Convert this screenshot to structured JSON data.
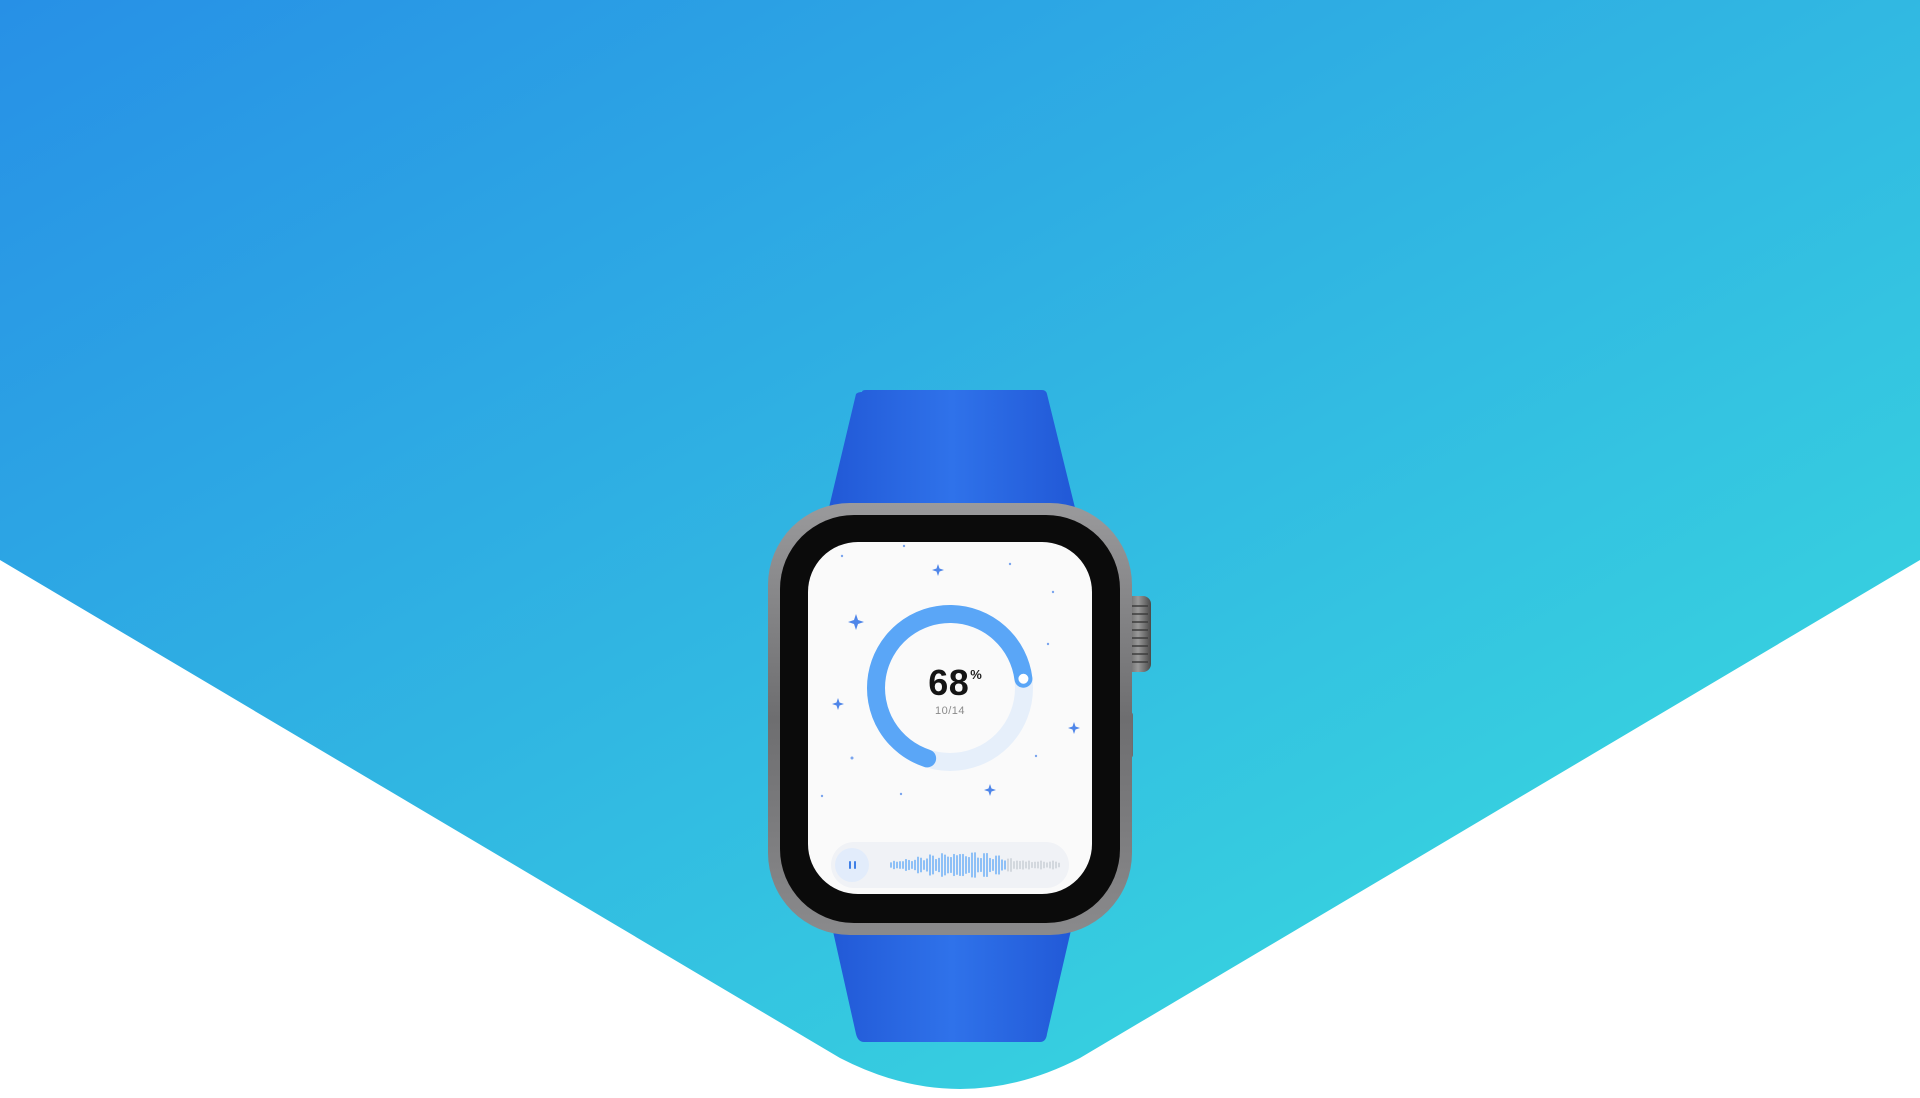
{
  "progress": {
    "value": "68",
    "unit": "%",
    "fraction": 0.68,
    "count": "10/14"
  },
  "player": {
    "state": "playing",
    "played_fraction": 0.68
  },
  "colors": {
    "background_gradient_start": "#2790e6",
    "background_gradient_end": "#3be1de",
    "band": "#2d6ee4",
    "ring_progress": "#5aa6f7",
    "ring_track": "#e6effa",
    "accent": "#3f7fe6"
  },
  "icons": {
    "pause": "pause-icon",
    "sparkle": "sparkle-icon"
  }
}
